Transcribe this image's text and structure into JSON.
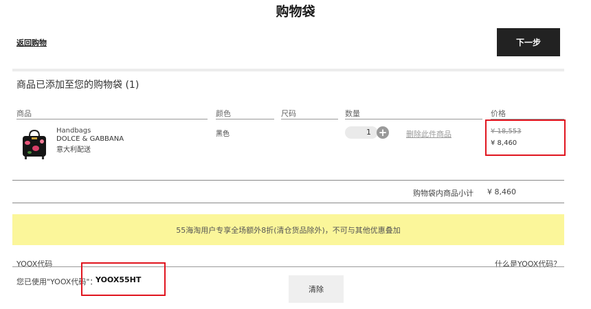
{
  "header": {
    "title": "购物袋",
    "back_label": "返回购物",
    "next_label": "下一步"
  },
  "cart": {
    "added_message": "商品已添加至您的购物袋 (1)",
    "columns": {
      "product": "商品",
      "color": "颜色",
      "size": "尺码",
      "quantity": "数量",
      "price": "价格"
    },
    "item": {
      "category": "Handbags",
      "brand": "DOLCE & GABBANA",
      "shipping": "意大利配送",
      "color": "黑色",
      "quantity": "1",
      "plus_glyph": "+",
      "remove_label": "删除此件商品",
      "original_price": "¥ 18,553",
      "price": "¥ 8,460",
      "image_icon": "handbag-floral-icon"
    },
    "subtotal_label": "购物袋内商品小计",
    "subtotal_value": "¥ 8,460"
  },
  "promo_banner": "55海淘用户专享全场额外8折(清仓货品除外)，不可与其他优惠叠加",
  "yoox": {
    "label": "YOOX代码",
    "help_link": "什么是YOOX代码？",
    "used_text": "您已使用\"YOOX代码\"：",
    "code": "YOOX55HT",
    "clear_label": "清除"
  },
  "colors": {
    "highlight_box": "#e0141e",
    "banner_bg": "#fbf69a",
    "button_dark": "#222222"
  }
}
